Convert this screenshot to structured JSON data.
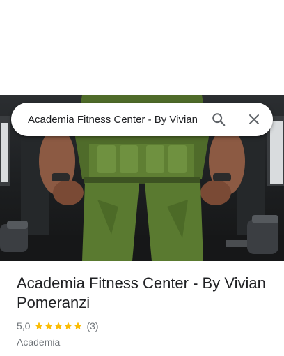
{
  "search": {
    "value": "Academia Fitness Center - By Vivian",
    "search_icon": "search-icon",
    "close_icon": "close-icon"
  },
  "hero_image": {
    "description_icon": "place-photo"
  },
  "place": {
    "title": "Academia Fitness Center - By Vivian Pomeranzi",
    "rating_value": "5,0",
    "rating": 5,
    "max_rating": 5,
    "review_count": "(3)",
    "category": "Academia"
  },
  "colors": {
    "star": "#fbbc04",
    "secondary_text": "#70757a",
    "primary_text": "#202124"
  }
}
